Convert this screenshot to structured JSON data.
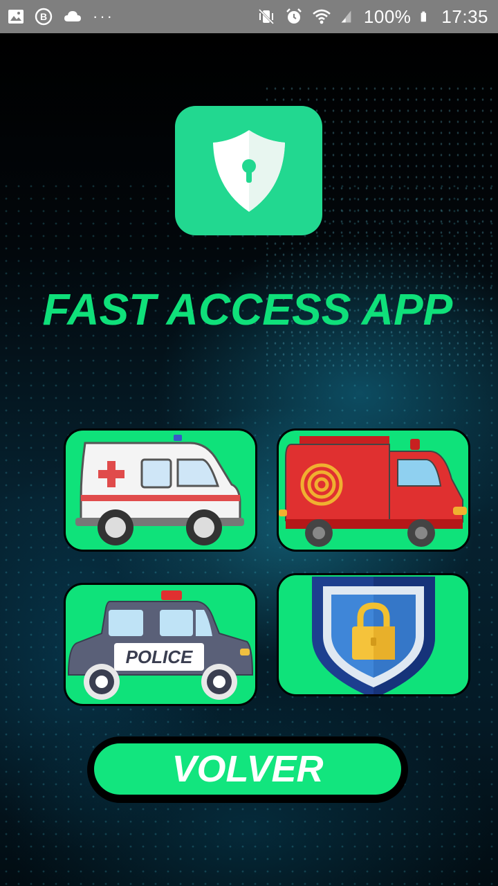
{
  "status_bar": {
    "battery": "100%",
    "time": "17:35",
    "overflow": "···",
    "left_icons": [
      "gallery-icon",
      "b-badge-icon",
      "cloud-icon"
    ],
    "right_icons": [
      "mute-vibrate-icon",
      "alarm-icon",
      "wifi-icon",
      "signal-icon",
      "battery-icon"
    ]
  },
  "app": {
    "title": "FAST ACCESS APP",
    "logo_icon": "shield-lock-icon",
    "accent_color": "#0fe27a"
  },
  "tiles": [
    {
      "icon": "ambulance-icon",
      "label": "Ambulance"
    },
    {
      "icon": "fire-truck-icon",
      "label": "Fire truck"
    },
    {
      "icon": "police-car-icon",
      "label": "POLICE"
    },
    {
      "icon": "security-shield-icon",
      "label": "Security"
    }
  ],
  "police_label": "POLICE",
  "back_button": {
    "label": "VOLVER"
  }
}
